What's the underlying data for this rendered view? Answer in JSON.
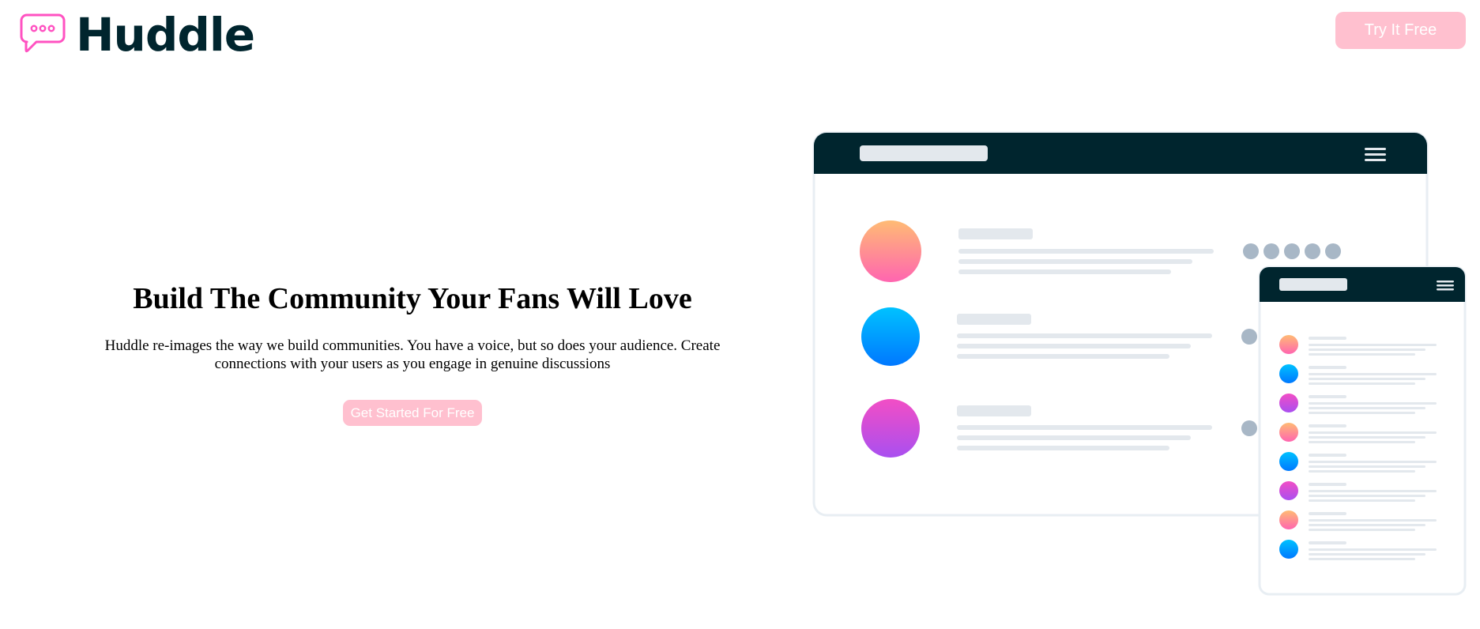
{
  "header": {
    "brand": "Huddle",
    "cta_label": "Try It Free"
  },
  "hero": {
    "title": "Build The Community Your Fans Will Love",
    "description": "Huddle re-images the way we build communities. You have a voice, but so does your audience. Create connections with your users as you engage in genuine discussions",
    "cta_label": "Get Started For Free"
  },
  "colors": {
    "brand_dark": "#00252e",
    "brand_pink": "#ff52c1",
    "button_pink": "#ffc0cf",
    "placeholder_line": "#e3e8ed",
    "dot_grey": "#a8b7c6"
  },
  "icons": {
    "logo": "speech-bubble-icon",
    "menu": "hamburger-menu-icon"
  }
}
